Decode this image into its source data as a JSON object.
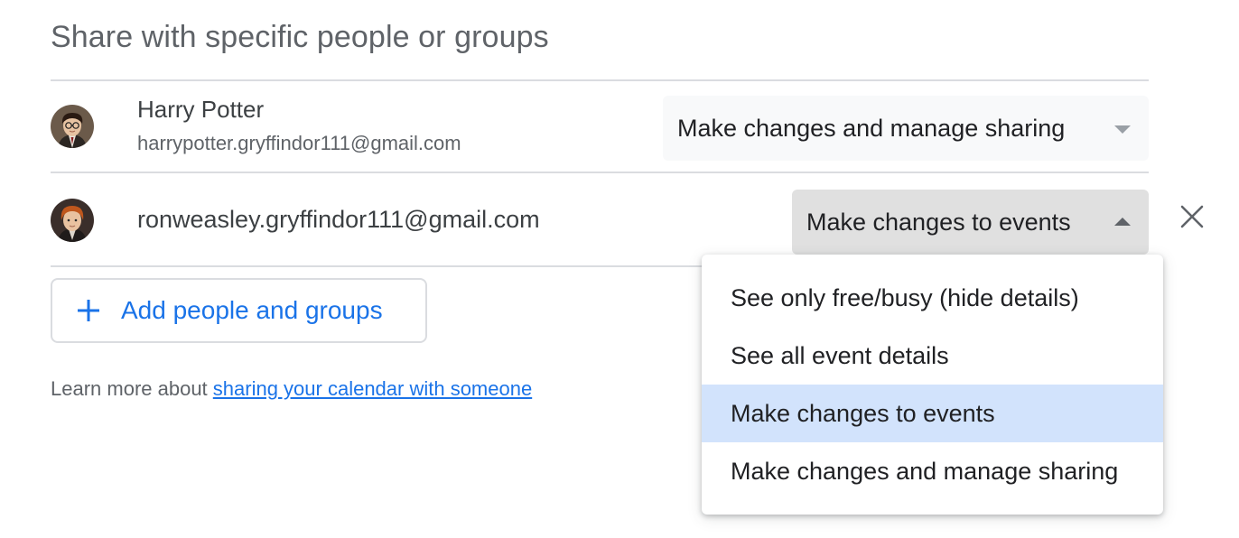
{
  "section": {
    "title": "Share with specific people or groups"
  },
  "people": [
    {
      "name": "Harry Potter",
      "email": "harrypotter.gryffindor111@gmail.com",
      "permission": "Make changes and manage sharing",
      "avatar_icon": "harry-potter-avatar"
    },
    {
      "email": "ronweasley.gryffindor111@gmail.com",
      "permission": "Make changes to events",
      "avatar_icon": "ron-weasley-avatar"
    }
  ],
  "permission_menu": {
    "options": [
      "See only free/busy (hide details)",
      "See all event details",
      "Make changes to events",
      "Make changes and manage sharing"
    ],
    "selected": "Make changes to events"
  },
  "add_button": {
    "label": "Add people and groups",
    "icon": "plus-icon"
  },
  "learn_more": {
    "prefix": "Learn more about ",
    "link": "sharing your calendar with someone"
  },
  "colors": {
    "accent": "#1a73e8",
    "selected_option_bg": "#d2e3fc",
    "open_select_bg": "#e0e0e0",
    "divider": "#dadce0"
  }
}
